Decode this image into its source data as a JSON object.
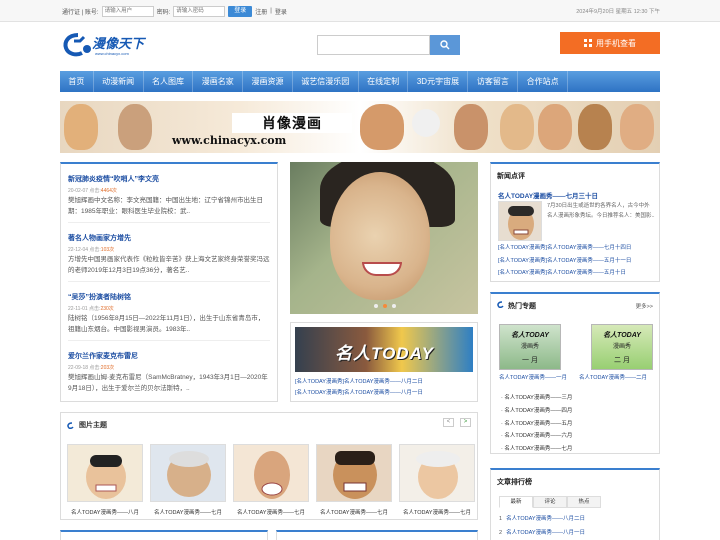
{
  "topbar": {
    "login_label": "通行证 | 账号:",
    "account_placeholder": "请输入用户",
    "password_label": "密码:",
    "password_placeholder": "请输入密码",
    "login_button": "登录",
    "register_link": "注册",
    "signin_link": "登录",
    "date": "2024年9月20日 星期五 12:30 下午"
  },
  "header": {
    "logo_text": "漫像天下",
    "logo_url": "www.chinacyx.com",
    "search_placeholder": "",
    "mobile_button": "用手机查看"
  },
  "nav": {
    "items": [
      "首页",
      "动漫新闻",
      "名人图库",
      "漫画名家",
      "漫画资源",
      "诚艺信漫乐园",
      "在线定制",
      "3D元宇宙展",
      "访客留言",
      "合作站点"
    ]
  },
  "banner": {
    "title": "肖像漫画",
    "url": "www.chinacyx.com"
  },
  "news": [
    {
      "title": "新冠肺炎疫情“吹哨人”李文亮",
      "date": "20-02-07",
      "hits_label": "点击:",
      "hits": "4464次",
      "desc": "樊旭辉画中文名称：李文亮国籍：中国出生地：辽宁省锦州市出生日期：1985年职业：眼科医生毕业院校：武.."
    },
    {
      "title": "著名人物画家方增先",
      "date": "22-12-04",
      "hits_label": "点击:",
      "hits": "103次",
      "desc": "方增先中国男画家代表作《粒粒皆辛苦》获上海文艺家终身荣誉奖冯远的老师2019年12月3日19点36分，著名艺.."
    },
    {
      "title": "“吴莎”扮演者陆树铭",
      "date": "22-11-01",
      "hits_label": "点击:",
      "hits": "230次",
      "desc": "陆树铭（1956年8月15日—2022年11月1日），出生于山东省青岛市，祖籍山东烟台。中国影视男演员。1983年.."
    },
    {
      "title": "爱尔兰作家麦克布雷尼",
      "date": "22-09-18",
      "hits_label": "点击:",
      "hits": "203次",
      "desc": "樊旭辉画山姆·麦克布雷尼（SamMcBratney，1943年3月1日—2020年9月18日），出生于爱尔兰的贝尔法斯特，.."
    }
  ],
  "feature": {
    "slide_count": 3,
    "active_slide": 1
  },
  "today": {
    "banner_text": "名人TODAY",
    "links": [
      "[名人TODAY漫画秀]名人TODAY漫画秀——八月二日",
      "[名人TODAY漫画秀]名人TODAY漫画秀——八月一日"
    ]
  },
  "review": {
    "title": "新闻点评",
    "lead": "名人TODAY漫画秀——七月三十日",
    "desc": "7月30日出生或逝世的各界名人，古今中外名人漫画形象秀坛。今日推荐名人：美国影..",
    "links": [
      "[名人TODAY漫画秀]名人TODAY漫画秀——七月十四日",
      "[名人TODAY漫画秀]名人TODAY漫画秀——五月十一日",
      "[名人TODAY漫画秀]名人TODAY漫画秀——五月十日"
    ]
  },
  "hot": {
    "title": "热门专题",
    "more": "更多>>",
    "cards": [
      {
        "title": "名人TODAY",
        "sub": "漫画秀",
        "month": "一 月",
        "caption": "名人TODAY漫画秀——一月"
      },
      {
        "title": "名人TODAY",
        "sub": "漫画秀",
        "month": "二 月",
        "caption": "名人TODAY漫画秀——二月"
      }
    ],
    "list": [
      "名人TODAY漫画秀——三月",
      "名人TODAY漫画秀——四月",
      "名人TODAY漫画秀——五月",
      "名人TODAY漫画秀——六月",
      "名人TODAY漫画秀——七月"
    ]
  },
  "rank": {
    "title": "文章排行榜",
    "tabs": [
      "最新",
      "评论",
      "热点"
    ],
    "rows": [
      {
        "n": "1",
        "label": "名人TODAY漫画秀——八月二日"
      },
      {
        "n": "2",
        "label": "名人TODAY漫画秀——八月一日"
      }
    ]
  },
  "gallery": {
    "title": "图片主题",
    "prev": "<",
    "next": ">",
    "captions": [
      "名人TODAY漫画秀——八月",
      "名人TODAY漫画秀——七月",
      "名人TODAY漫画秀——七月",
      "名人TODAY漫画秀——七月",
      "名人TODAY漫画秀——七月"
    ]
  },
  "colors": {
    "accent": "#3a7fcf",
    "nav": "#2e73c4",
    "mobile": "#f36d24",
    "link": "#1e4fa3",
    "hits": "#e06d2a"
  }
}
